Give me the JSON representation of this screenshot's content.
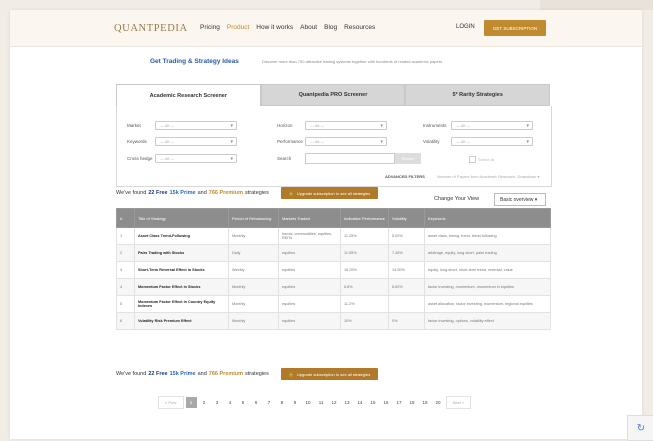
{
  "header": {
    "logo": "QUANTPEDIA",
    "nav": [
      "Pricing",
      "Product",
      "How it works",
      "About",
      "Blog",
      "Resources"
    ],
    "active_nav": "Product",
    "login": "LOGIN",
    "cta": "GET SUBSCRIPTION"
  },
  "hero": {
    "headline": "Get Trading & Strategy Ideas",
    "subline": "Discover more than 700 attractive trading systems together with hundreds of related academic papers"
  },
  "tabs": [
    "Academic Research Screener",
    "Quantpedia PRO Screener",
    "5* Rarity Strategies"
  ],
  "filters": {
    "labels": {
      "market": "Market",
      "keywords": "Keywords",
      "cross_hedge": "Cross hedge",
      "horizon": "Horizon",
      "performance": "Performance",
      "search": "Search",
      "instruments": "Instruments",
      "volatility": "Volatility"
    },
    "placeholder": "— All —",
    "search_button": "Search",
    "checkbox": "Select all",
    "advanced": "ADVANCED FILTERS",
    "advanced_hint": "Number of Papers from Academic Research, Drawdown ▾"
  },
  "found": {
    "prefix": "We've found",
    "total": "22 Free",
    "free": "15k Prime",
    "and": "and",
    "premium": "766 Premium",
    "suffix": "strategies",
    "upgrade": "Upgrade subscription to see all strategies"
  },
  "view": {
    "label": "Change Your View",
    "selected": "Basic overview ▾"
  },
  "table": {
    "headers": [
      "#",
      "Title of Strategy",
      "Period of Rebalancing",
      "Markets Traded",
      "Indicative Performance",
      "Volatility",
      "Keywords"
    ],
    "rows": [
      [
        "1",
        "Asset Class Trend-Following",
        "Monthly",
        "bonds, commodities, equities, REITs",
        "11.25%",
        "5.00%",
        "asset class, timing, trend, trend-following"
      ],
      [
        "2",
        "Pairs Trading with Stocks",
        "Daily",
        "equities",
        "11.55%",
        "7.45%",
        "arbitrage, equity, long short, pairs trading"
      ],
      [
        "3",
        "Short-Term Reversal Effect in Stocks",
        "Weekly",
        "equities",
        "16.25%",
        "14.00%",
        "equity, long-short, short-term trend, reversal, value"
      ],
      [
        "4",
        "Momentum Factor Effect in Stocks",
        "Monthly",
        "equities",
        "6.8%",
        "8.60%",
        "factor investing, momentum, momentum in equities"
      ],
      [
        "5",
        "Momentum Factor Effect in Country Equity Indexes",
        "Monthly",
        "equities",
        "11.2%",
        "",
        "asset allocation, factor investing, momentum, regional equities"
      ],
      [
        "6",
        "Volatility Risk Premium Effect",
        "Monthly",
        "equities",
        "10%",
        "0%",
        "factor investing, options, volatility effect"
      ]
    ]
  },
  "pagination": {
    "prev": "« Prev",
    "pages": [
      "1",
      "2",
      "3",
      "4",
      "5",
      "6",
      "7",
      "8",
      "9",
      "10",
      "11",
      "12",
      "13",
      "14",
      "15",
      "16",
      "17",
      "18",
      "19",
      "20"
    ],
    "current": "1",
    "next": "Next »"
  }
}
